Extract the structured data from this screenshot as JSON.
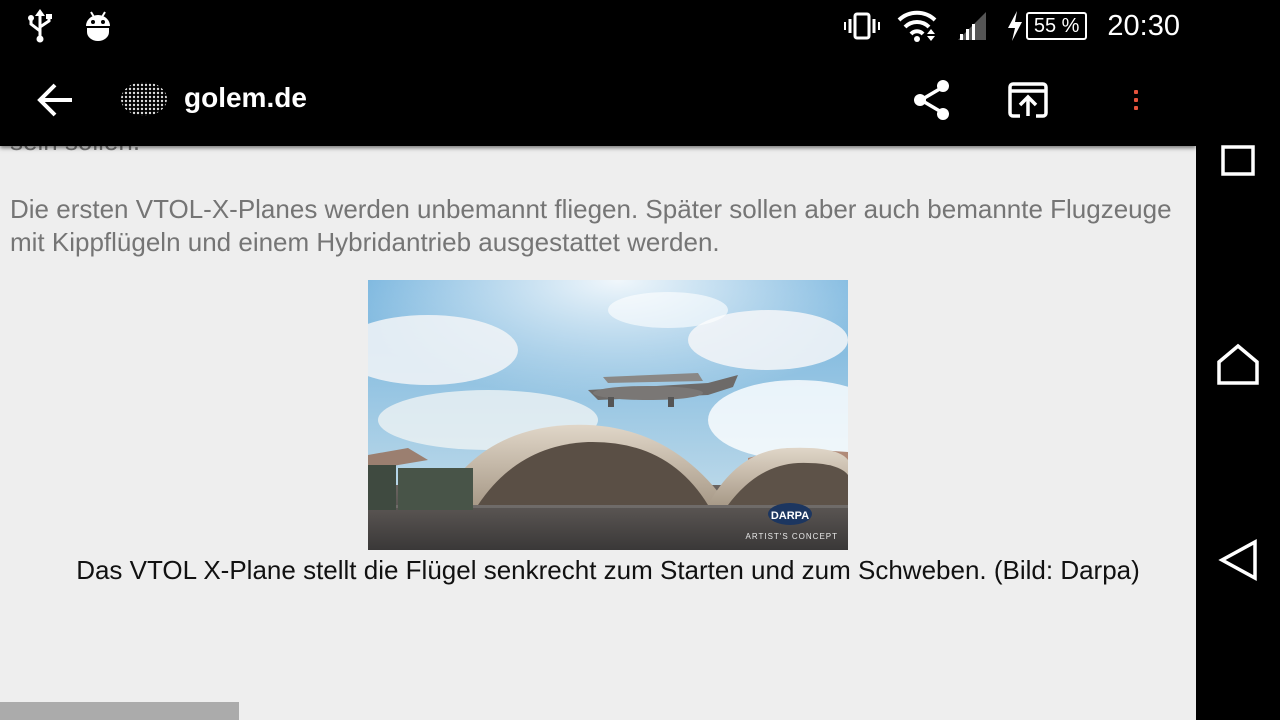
{
  "status_bar": {
    "battery": "55 %",
    "time": "20:30"
  },
  "toolbar": {
    "title": "golem.de"
  },
  "article": {
    "cut_text": "sein sollen.",
    "paragraph": "Die ersten VTOL-X-Planes werden unbemannt fliegen. Später sollen aber auch bemannte Flugzeuge mit Kippflügeln und einem Hybridantrieb ausgestattet werden.",
    "image": {
      "logo_text": "DARPA",
      "overlay_text": "ARTIST'S CONCEPT"
    },
    "caption": "Das VTOL X-Plane stellt die Flügel senkrecht zum Starten und zum Schweben. (Bild: Darpa)"
  },
  "page_progress": 0.2,
  "icons": {
    "usb": "usb-icon",
    "android": "android-debug-icon",
    "vibrate": "vibrate-icon",
    "wifi": "wifi-icon",
    "signal": "cell-signal-icon",
    "charging": "charging-icon",
    "back": "arrow-back-icon",
    "share": "share-icon",
    "open": "open-in-browser-icon",
    "more": "more-vert-icon",
    "recents": "recents-square-icon",
    "home": "home-icon",
    "nav_back": "nav-back-triangle-icon"
  },
  "colors": {
    "accent": "#e5533d",
    "page_bg": "#eeeeee",
    "body_text": "#757575"
  }
}
